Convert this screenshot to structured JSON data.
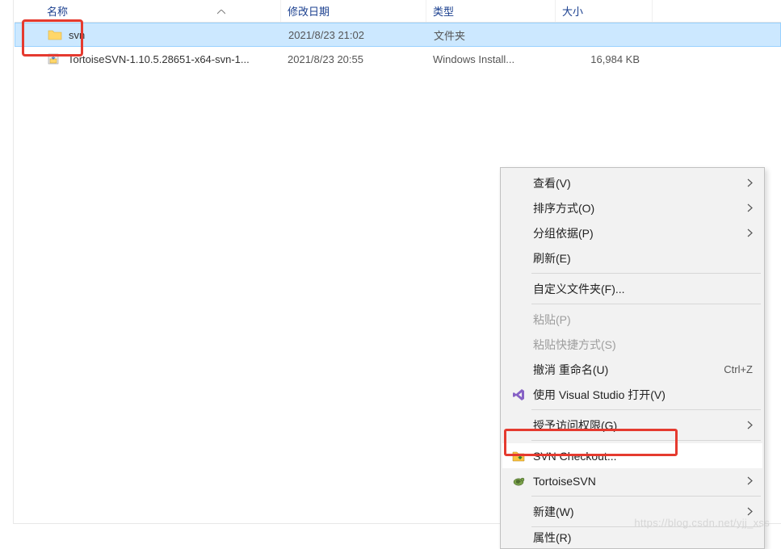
{
  "columns": {
    "name": "名称",
    "date": "修改日期",
    "type": "类型",
    "size": "大小"
  },
  "rows": [
    {
      "name": "svn",
      "date": "2021/8/23 21:02",
      "type": "文件夹",
      "size": ""
    },
    {
      "name": "TortoiseSVN-1.10.5.28651-x64-svn-1...",
      "date": "2021/8/23 20:55",
      "type": "Windows Install...",
      "size": "16,984 KB"
    }
  ],
  "menu": {
    "view": "查看(V)",
    "sort": "排序方式(O)",
    "group": "分组依据(P)",
    "refresh": "刷新(E)",
    "customize": "自定义文件夹(F)...",
    "paste": "粘贴(P)",
    "paste_shortcut": "粘贴快捷方式(S)",
    "undo_rename": "撤消 重命名(U)",
    "undo_rename_kb": "Ctrl+Z",
    "vs_open": "使用 Visual Studio 打开(V)",
    "grant_access": "授予访问权限(G)",
    "svn_checkout": "SVN Checkout...",
    "tortoisesvn": "TortoiseSVN",
    "new": "新建(W)",
    "properties": "属性(R)"
  },
  "watermark": "https://blog.csdn.net/yjj_xss"
}
